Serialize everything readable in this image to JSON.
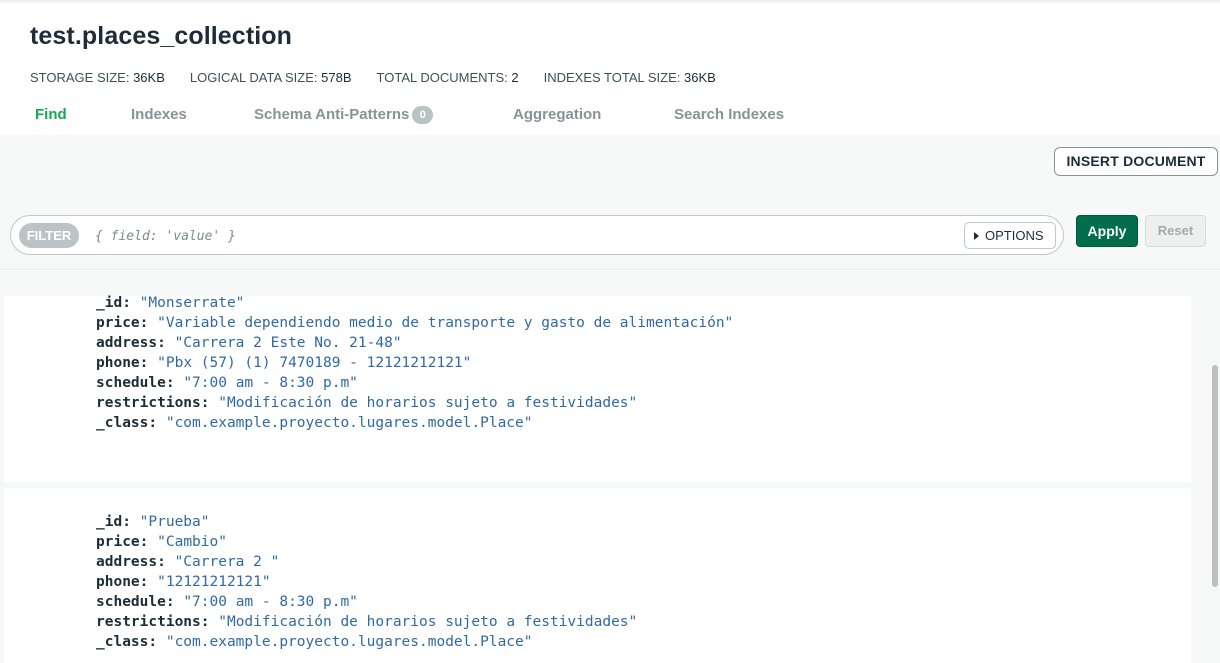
{
  "collection": {
    "title": "test.places_collection"
  },
  "stats": [
    {
      "label": "STORAGE SIZE:",
      "value": "36KB"
    },
    {
      "label": "LOGICAL DATA SIZE:",
      "value": "578B"
    },
    {
      "label": "TOTAL DOCUMENTS:",
      "value": "2"
    },
    {
      "label": "INDEXES TOTAL SIZE:",
      "value": "36KB"
    }
  ],
  "tabs": [
    {
      "label": "Find",
      "active": true
    },
    {
      "label": "Indexes"
    },
    {
      "label": "Schema Anti-Patterns",
      "badge": "0"
    },
    {
      "label": "Aggregation"
    },
    {
      "label": "Search Indexes"
    }
  ],
  "toolbar": {
    "insert_label": "INSERT DOCUMENT",
    "filter_label": "FILTER",
    "filter_placeholder": "{ field: 'value' }",
    "options_label": "OPTIONS",
    "apply_label": "Apply",
    "reset_label": "Reset"
  },
  "documents": [
    {
      "fields": [
        {
          "key": "_id:",
          "value": "\"Monserrate\""
        },
        {
          "key": "price:",
          "value": "\"Variable dependiendo medio de transporte y gasto de alimentación\""
        },
        {
          "key": "address:",
          "value": "\"Carrera 2 Este No. 21-48\""
        },
        {
          "key": "phone:",
          "value": "\"Pbx (57) (1) 7470189 - 12121212121\""
        },
        {
          "key": "schedule:",
          "value": "\"7:00 am - 8:30 p.m\""
        },
        {
          "key": "restrictions:",
          "value": "\"Modificación de horarios sujeto a festividades\""
        },
        {
          "key": "_class:",
          "value": "\"com.example.proyecto.lugares.model.Place\""
        }
      ]
    },
    {
      "fields": [
        {
          "key": "_id:",
          "value": "\"Prueba\""
        },
        {
          "key": "price:",
          "value": "\"Cambio\""
        },
        {
          "key": "address:",
          "value": "\"Carrera 2 \""
        },
        {
          "key": "phone:",
          "value": "\"12121212121\""
        },
        {
          "key": "schedule:",
          "value": "\"7:00 am - 8:30 p.m\""
        },
        {
          "key": "restrictions:",
          "value": "\"Modificación de horarios sujeto a festividades\""
        },
        {
          "key": "_class:",
          "value": "\"com.example.proyecto.lugares.model.Place\""
        }
      ]
    }
  ],
  "colors": {
    "active_tab": "#13aa52",
    "apply_button": "#016d4c",
    "doc_value": "#2f69a6"
  }
}
